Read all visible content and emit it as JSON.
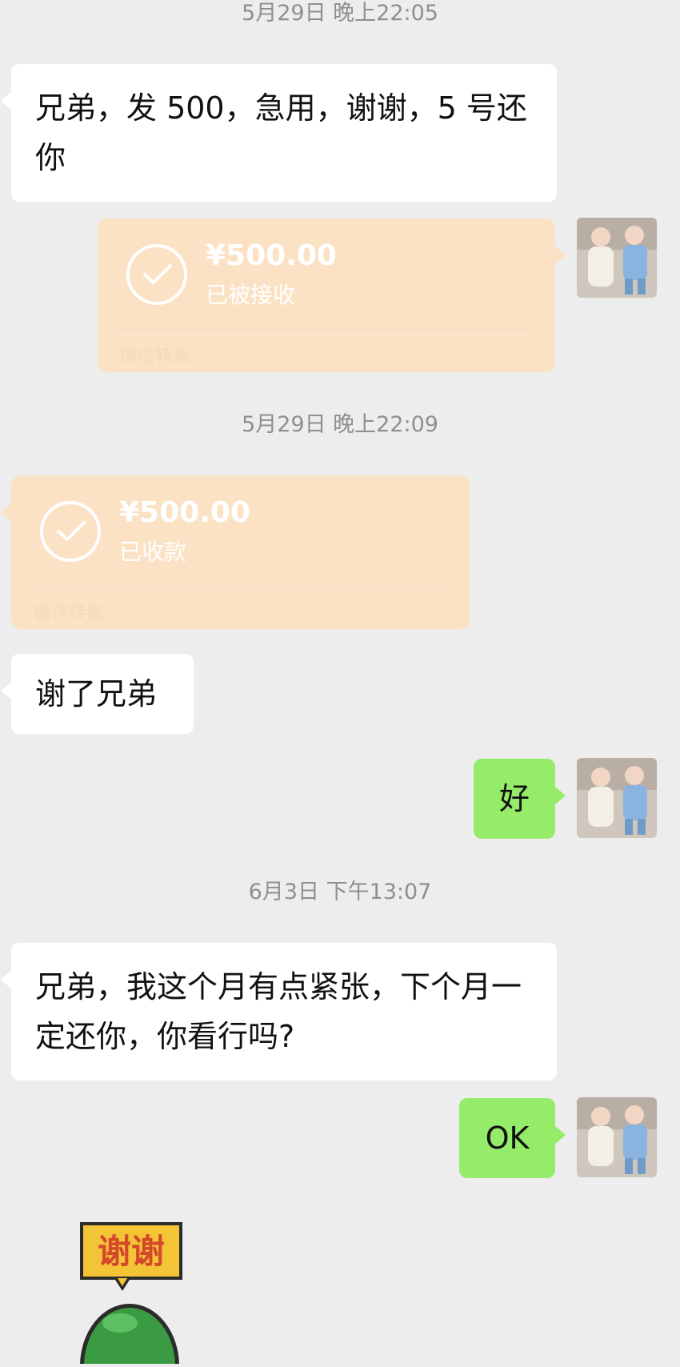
{
  "chat": {
    "ts1": "5月29日 晚上22:05",
    "msg1": "兄弟，发 500，急用，谢谢，5 号还你",
    "transfer1": {
      "amount": "¥500.00",
      "status": "已被接收",
      "brand": "微信转账"
    },
    "ts2": "5月29日 晚上22:09",
    "transfer2": {
      "amount": "¥500.00",
      "status": "已收款",
      "brand": "微信转账"
    },
    "msg2": "谢了兄弟",
    "reply1": "好",
    "ts3": "6月3日 下午13:07",
    "msg3": "兄弟，我这个月有点紧张，下个月一定还你，你看行吗?",
    "reply2": "OK",
    "sticker": {
      "label": "谢谢"
    }
  },
  "colors": {
    "background": "#ededed",
    "incoming_bubble": "#ffffff",
    "outgoing_bubble": "#95ec69",
    "transfer_card": "#fce2c4"
  },
  "icons": {
    "transfer_status": "check-circle-icon",
    "avatar": "user-photo-avatar"
  }
}
